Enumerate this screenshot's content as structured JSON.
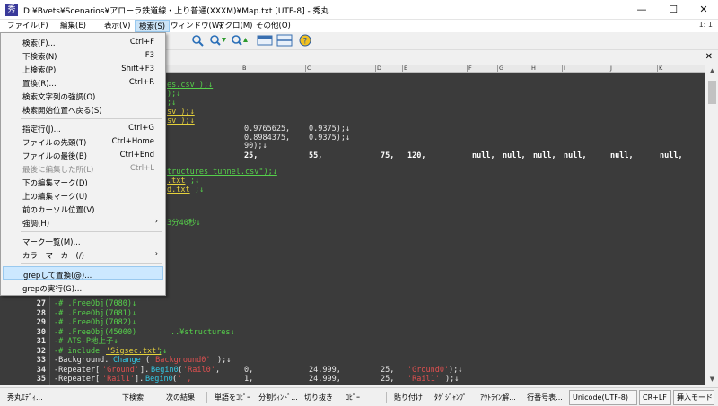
{
  "window": {
    "title": "D:¥Bvets¥Scenarios¥アローラ鉄道線・上り普通(XXXM)¥Map.txt [UTF-8] - 秀丸",
    "icon_label": "秀",
    "minimize": "—",
    "maximize": "☐",
    "close": "✕"
  },
  "menubar": {
    "items": [
      {
        "label": "ファイル(F)"
      },
      {
        "label": "編集(E)"
      },
      {
        "label": "表示(V)"
      },
      {
        "label": "検索(S)"
      },
      {
        "label": "ウィンドウ(W)"
      },
      {
        "label": "マクロ(M)"
      },
      {
        "label": "その他(O)"
      }
    ],
    "line_col": "1: 1"
  },
  "toolbar": {
    "icons": [
      "search-icon",
      "search-down-icon",
      "search-up-icon",
      "window-icon",
      "split-icon",
      "help-icon"
    ]
  },
  "tabstrip": {
    "close": "✕"
  },
  "ruler": {
    "cols": [
      "B",
      "C",
      "D",
      "E",
      "F",
      "G",
      "H",
      "I",
      "J",
      "K"
    ]
  },
  "search_menu": {
    "items": [
      {
        "label": "検索(F)...",
        "shortcut": "Ctrl+F"
      },
      {
        "label": "下検索(N)",
        "shortcut": "F3"
      },
      {
        "label": "上検索(P)",
        "shortcut": "Shift+F3"
      },
      {
        "label": "置換(R)...",
        "shortcut": "Ctrl+R"
      },
      {
        "label": "検索文字列の強調(O)",
        "shortcut": ""
      },
      {
        "label": "検索開始位置へ戻る(S)",
        "shortcut": ""
      },
      {
        "label": "指定行(J)...",
        "shortcut": "Ctrl+G"
      },
      {
        "label": "ファイルの先頭(T)",
        "shortcut": "Ctrl+Home"
      },
      {
        "label": "ファイルの最後(B)",
        "shortcut": "Ctrl+End"
      },
      {
        "label": "最後に編集した所(L)",
        "shortcut": "Ctrl+L"
      },
      {
        "label": "下の編集マーク(D)",
        "shortcut": ""
      },
      {
        "label": "上の編集マーク(U)",
        "shortcut": ""
      },
      {
        "label": "前のカーソル位置(V)",
        "shortcut": ""
      },
      {
        "label": "強調(H)",
        "shortcut": ""
      },
      {
        "label": "マーク一覧(M)...",
        "shortcut": ""
      },
      {
        "label": "カラーマーカー(/)",
        "shortcut": ""
      },
      {
        "label": "grepして置換(@)...",
        "shortcut": ""
      },
      {
        "label": "grepの実行(G)...",
        "shortcut": ""
      }
    ],
    "submenu_arrow": "›"
  },
  "editor": {
    "line_numbers": [
      "27",
      "28",
      "29",
      "30",
      "31",
      "32",
      "33",
      "34",
      "35"
    ],
    "frag": {
      "r1": "es.csv );↓",
      "r2": ");↓",
      "r3": ";↓",
      "r4": "sv );↓",
      "r5": "sv );↓",
      "r6a": "0.9765625,",
      "r6b": "0.9375);↓",
      "r7a": "0.8984375,",
      "r7b": "0.9375);↓",
      "r8": "90);↓",
      "r9": [
        "25,",
        "55,",
        "75,",
        "120,",
        "null,",
        "null,",
        "null,",
        "null,",
        "null,",
        "null,"
      ],
      "r10": "tructures_tunnel.csv\");↓",
      "r11a": ".txt",
      "r11b": ";↓",
      "r12a": "d.txt",
      "r12b": ";↓",
      "r13": "3分40秒↓",
      "l27": "-# .FreeObj(7080)↓",
      "l28": "-# .FreeObj(7081)↓",
      "l29": "-# .FreeObj(7082)↓",
      "l30a": "-# .FreeObj(45000)",
      "l30b": "..¥structures↓",
      "l31": "-# ATS-P地上子↓",
      "l32a": "-# include",
      "l32b": "'Sigsec.txt'",
      "l32c": ";↓",
      "l33a": "-Background.",
      "l33b": "Change",
      "l33c": "(",
      "l33d": "'Background0'",
      "l33e": ");↓",
      "l34a": "-Repeater[",
      "l34b": "'Ground'",
      "l34c": "].",
      "l34d": "Begin0",
      "l34e": "(",
      "l34f": "'Rail0'",
      "l34g": ",",
      "l34h": "0,",
      "l34i": "24.999,",
      "l34j": "25,",
      "l34k": "'Ground0'",
      "l34l": ");↓",
      "l35a": "-Repeater[",
      "l35b": "'Rail1'",
      "l35c": "].",
      "l35d": "Begin0",
      "l35e": "(",
      "l35f": "' ,",
      "l35h": "1,",
      "l35i": "24.999,",
      "l35j": "25,",
      "l35k": "'Rail1'",
      "l35l": ");↓"
    }
  },
  "fkeybar": {
    "keys": [
      "秀丸ｴﾃﾞｨ...",
      "下検索",
      "次の結果",
      "単語をｺﾋﾟｰ",
      "分割ｳｨﾝﾄﾞ...",
      "切り抜き",
      "ｺﾋﾟｰ",
      "貼り付け",
      "ﾀｸﾞｼﾞｬﾝﾌﾟ",
      "ｱｳﾄﾗｲﾝ解...",
      "行番号表..."
    ],
    "encoding": "Unicode(UTF-8)",
    "line_ending": "CR+LF",
    "insert_mode": "挿入モード"
  }
}
